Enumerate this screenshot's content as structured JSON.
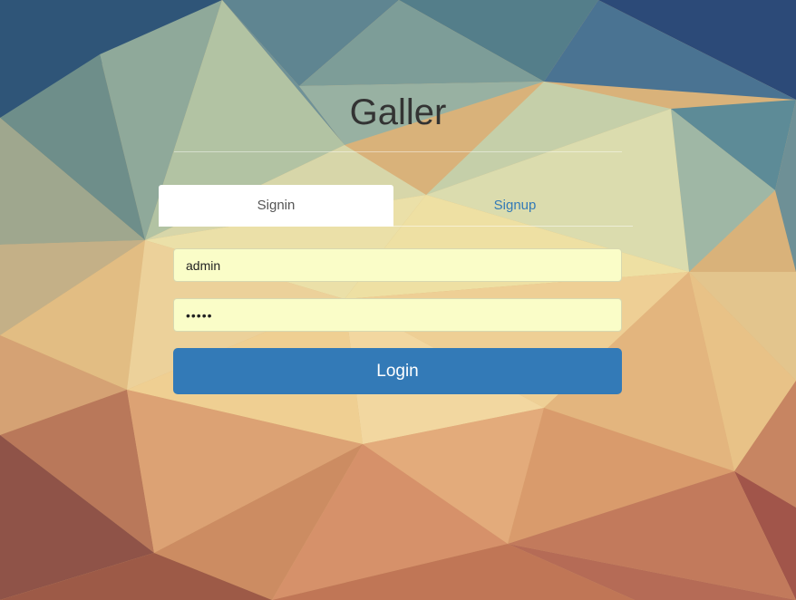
{
  "header": {
    "title": "Galler"
  },
  "tabs": [
    {
      "label": "Signin",
      "active": true
    },
    {
      "label": "Signup",
      "active": false
    }
  ],
  "form": {
    "username_value": "admin",
    "password_value": "•••••",
    "login_label": "Login"
  },
  "colors": {
    "primary": "#337ab7",
    "input_background": "#fafdc8",
    "title_text": "#333333"
  }
}
